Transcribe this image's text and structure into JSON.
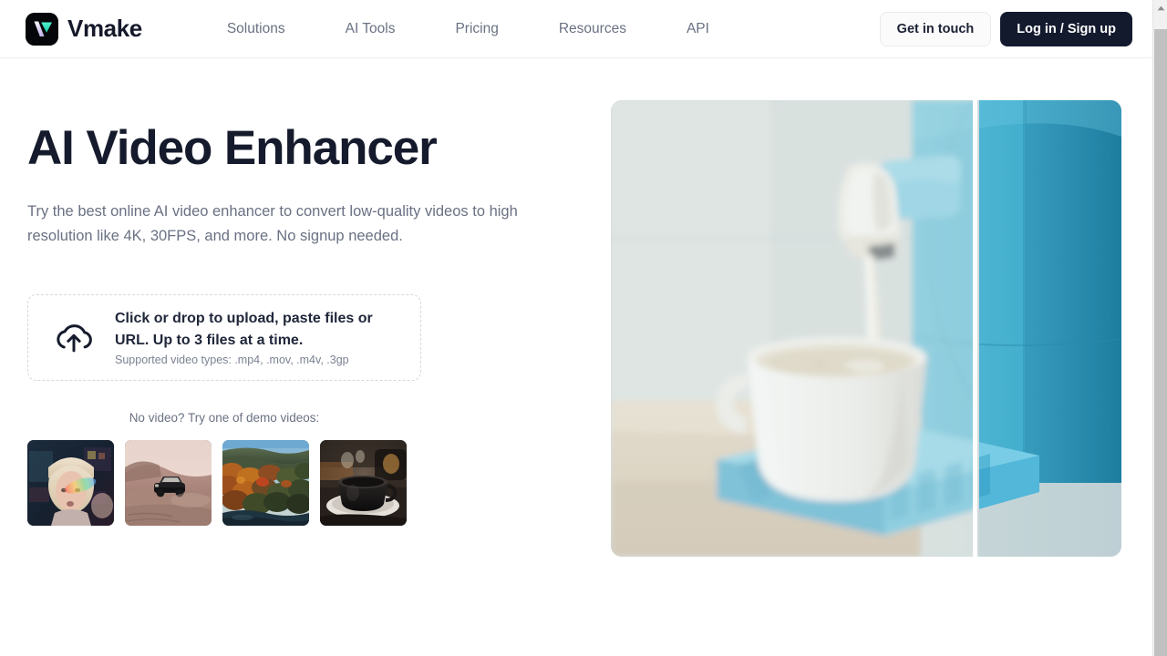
{
  "brand": {
    "name": "Vmake",
    "logo_icon": "vmake-logo-icon",
    "logo_bg": "#05060a",
    "logo_teal": "#3fe0c0",
    "logo_lavender": "#c9b8ef"
  },
  "nav": {
    "items": [
      {
        "label": "Solutions"
      },
      {
        "label": "AI Tools"
      },
      {
        "label": "Pricing"
      },
      {
        "label": "Resources"
      },
      {
        "label": "API"
      }
    ]
  },
  "header_actions": {
    "contact_label": "Get in touch",
    "auth_label": "Log in / Sign up",
    "primary_color": "#131a2e"
  },
  "hero": {
    "title": "AI Video Enhancer",
    "subtitle": "Try the best online AI video enhancer to convert low-quality videos to high resolution like 4K, 30FPS, and more. No signup needed."
  },
  "upload": {
    "icon": "cloud-upload-icon",
    "title": "Click or drop to upload, paste files or URL. Up to 3 files at a time.",
    "note": "Supported video types: .mp4, .mov, .m4v, .3gp"
  },
  "demos": {
    "label": "No video? Try one of demo videos:",
    "items": [
      {
        "name": "demo-video-portrait-rainbow-light"
      },
      {
        "name": "demo-video-desert-car"
      },
      {
        "name": "demo-video-autumn-forest"
      },
      {
        "name": "demo-video-coffee-cup"
      }
    ]
  },
  "hero_media": {
    "name": "before-after-comparison-image",
    "description": "Espresso machine pouring milk into a white cup on a blue drip tray",
    "divider_color": "#ffffff"
  },
  "scrollbar": {
    "up_arrow_icon": "scroll-up-arrow-icon",
    "thumb_name": "scrollbar-thumb"
  }
}
